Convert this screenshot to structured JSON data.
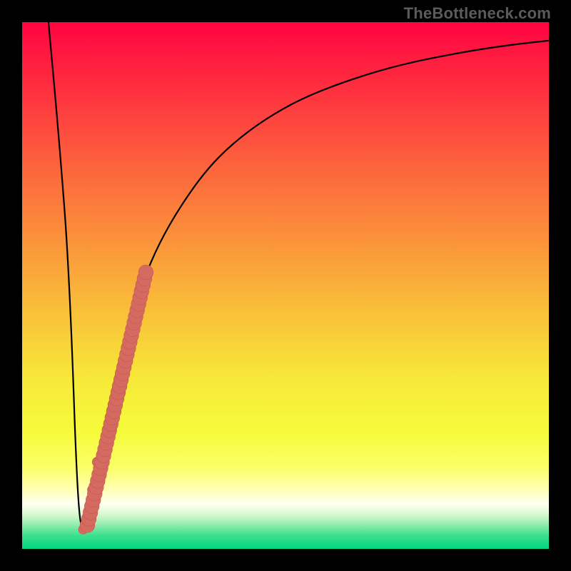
{
  "watermark": "TheBottleneck.com",
  "colors": {
    "frame": "#000000",
    "curve": "#000000",
    "dots": "#d46a60",
    "dots_stroke": "#c2594f"
  },
  "gradient_stops": [
    {
      "offset": 0.0,
      "color": "#fe0540"
    },
    {
      "offset": 0.12,
      "color": "#fe2d3f"
    },
    {
      "offset": 0.25,
      "color": "#fd5b3d"
    },
    {
      "offset": 0.4,
      "color": "#fb8e3b"
    },
    {
      "offset": 0.55,
      "color": "#f9c039"
    },
    {
      "offset": 0.68,
      "color": "#f7e939"
    },
    {
      "offset": 0.78,
      "color": "#f6fb3b"
    },
    {
      "offset": 0.845,
      "color": "#fbff68"
    },
    {
      "offset": 0.885,
      "color": "#ffffaf"
    },
    {
      "offset": 0.915,
      "color": "#fefff2"
    },
    {
      "offset": 0.935,
      "color": "#d7f9cf"
    },
    {
      "offset": 0.955,
      "color": "#8eecab"
    },
    {
      "offset": 0.975,
      "color": "#3adf8e"
    },
    {
      "offset": 1.0,
      "color": "#00d77e"
    }
  ],
  "chart_data": {
    "type": "line",
    "title": "",
    "xlabel": "",
    "ylabel": "",
    "xlim": [
      0,
      100
    ],
    "ylim": [
      0,
      100
    ],
    "series": [
      {
        "name": "bottleneck-curve",
        "x": [
          5,
          7,
          9,
          10.7,
          12,
          14,
          16,
          18,
          20,
          23,
          26,
          30,
          35,
          40,
          46,
          53,
          62,
          72,
          83,
          92,
          100
        ],
        "y": [
          100,
          78,
          52,
          3.5,
          6,
          15,
          25,
          34,
          42,
          51,
          58,
          65,
          72,
          77,
          81.5,
          85.5,
          89,
          92,
          94.2,
          95.6,
          96.5
        ]
      }
    ],
    "dot_band": {
      "name": "highlighted-range",
      "start": {
        "x": 12.4,
        "y": 4.5
      },
      "end": {
        "x": 23.5,
        "y": 52.5
      },
      "lead_dots": [
        {
          "x": 11.6,
          "y": 3.7,
          "r": 0.9
        },
        {
          "x": 13.3,
          "y": 11.2,
          "r": 0.9
        },
        {
          "x": 14.2,
          "y": 16.5,
          "r": 0.9
        }
      ],
      "thickness": 2.8
    }
  }
}
